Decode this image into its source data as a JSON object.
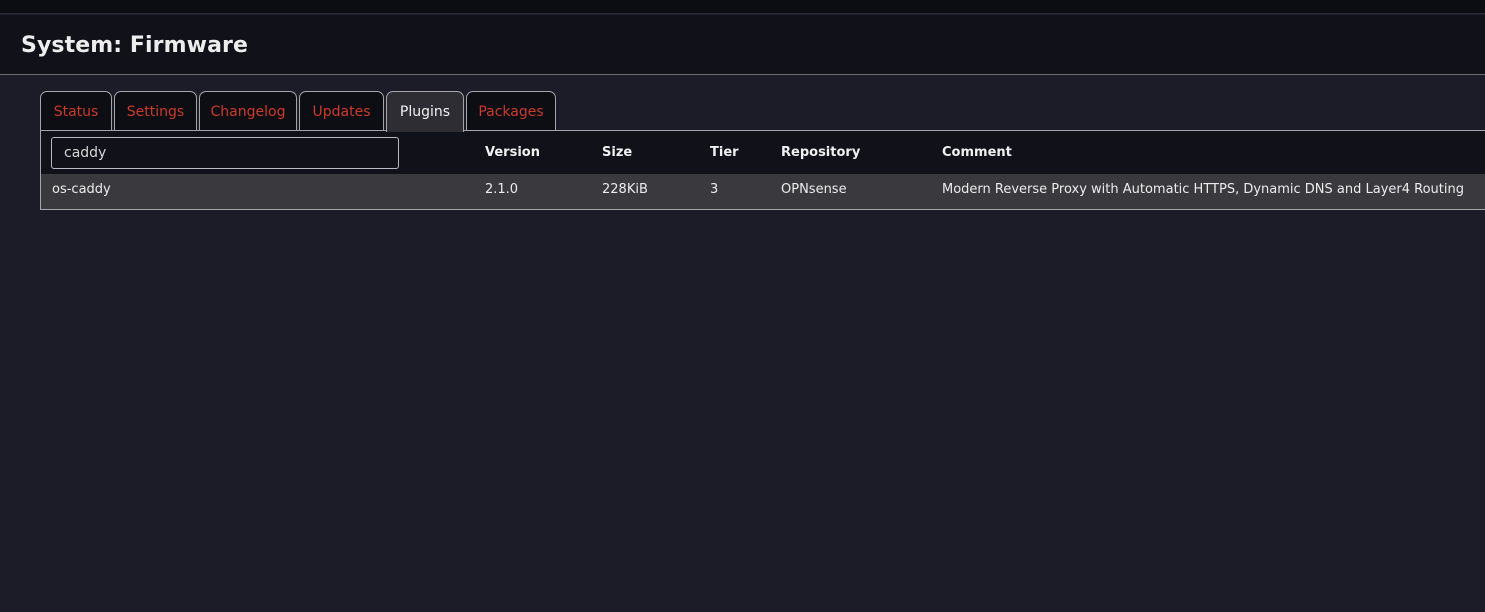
{
  "header": {
    "title": "System: Firmware"
  },
  "tabs": [
    {
      "label": "Status",
      "active": false
    },
    {
      "label": "Settings",
      "active": false
    },
    {
      "label": "Changelog",
      "active": false
    },
    {
      "label": "Updates",
      "active": false
    },
    {
      "label": "Plugins",
      "active": true
    },
    {
      "label": "Packages",
      "active": false
    }
  ],
  "search": {
    "value": "caddy"
  },
  "table": {
    "columns": [
      "Version",
      "Size",
      "Tier",
      "Repository",
      "Comment"
    ],
    "rows": [
      {
        "name": "os-caddy",
        "version": "2.1.0",
        "size": "228KiB",
        "tier": "3",
        "repository": "OPNsense",
        "comment": "Modern Reverse Proxy with Automatic HTTPS, Dynamic DNS and Layer4 Routing"
      }
    ]
  },
  "colors": {
    "background": "#1b1c28",
    "header": "#111219",
    "tab_link": "#cc3a2a",
    "active_tab": "#2d2d33",
    "row_highlight": "#3a3a3e"
  }
}
